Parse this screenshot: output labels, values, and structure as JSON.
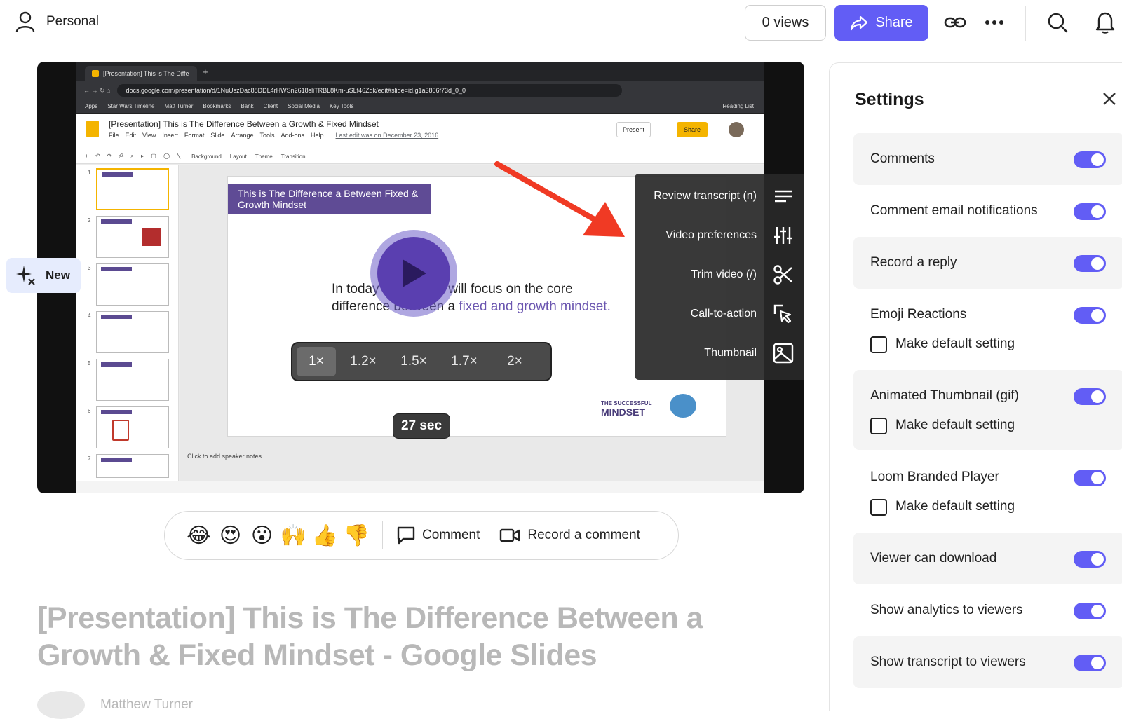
{
  "header": {
    "workspace": "Personal",
    "views_label": "0 views",
    "share_label": "Share"
  },
  "recording": {
    "browser_tab": "[Presentation] This is The Diffe",
    "url": "docs.google.com/presentation/d/1NuUszDac88DDL4rHWSn2618sliTRBL8Km-uSLf46Zqk/edit#slide=id.g1a3806f73d_0_0",
    "bookmarks": [
      "Apps",
      "Star Wars Timeline",
      "Matt Turner",
      "Bookmarks",
      "Bank",
      "Client",
      "Social Media",
      "Key Tools",
      "Reading List"
    ],
    "doc_title": "[Presentation] This is The Difference Between a Growth & Fixed Mindset",
    "doc_menu": [
      "File",
      "Edit",
      "View",
      "Insert",
      "Format",
      "Slide",
      "Arrange",
      "Tools",
      "Add-ons",
      "Help"
    ],
    "last_edit": "Last edit was on December 23, 2016",
    "present_label": "Present",
    "doc_share_label": "Share",
    "toolbar_items": [
      "Background",
      "Layout",
      "Theme",
      "Transition"
    ],
    "slide_title": "This is The  Difference a Between Fixed & Growth Mindset",
    "slide_text_1": "In today's video we will focus on the core",
    "slide_text_2": "difference between a",
    "slide_text_accent": "fixed and growth mindset.",
    "brand_top": "THE SUCCESSFUL",
    "brand_bottom": "MINDSET",
    "speaker_notes": "Click to add speaker notes",
    "slide_numbers": [
      "1",
      "2",
      "3",
      "4",
      "5",
      "6",
      "7"
    ]
  },
  "player": {
    "speeds": [
      "1×",
      "1.2×",
      "1.5×",
      "1.7×",
      "2×"
    ],
    "active_speed": "1×",
    "timer": "27 sec",
    "menu": [
      {
        "label": "Review transcript (n)",
        "icon": "lines-icon"
      },
      {
        "label": "Video preferences",
        "icon": "sliders-icon"
      },
      {
        "label": "Trim video (/)",
        "icon": "scissors-icon"
      },
      {
        "label": "Call-to-action",
        "icon": "cursor-icon"
      },
      {
        "label": "Thumbnail",
        "icon": "image-icon"
      }
    ],
    "accent_color": "#5a3fb0",
    "annotation_arrow_color": "#f03a24"
  },
  "new_badge": "New",
  "reactions": {
    "emojis": [
      "😂",
      "😍",
      "😮",
      "🙌",
      "👍",
      "👎"
    ],
    "comment_label": "Comment",
    "record_label": "Record a comment"
  },
  "video_title": "[Presentation] This is The Difference Between a Growth & Fixed Mindset - Google Slides",
  "author": "Matthew Turner",
  "settings": {
    "title": "Settings",
    "items": [
      {
        "label": "Comments",
        "on": true
      },
      {
        "label": "Comment email notifications",
        "on": true
      },
      {
        "label": "Record a reply",
        "on": true
      },
      {
        "label": "Emoji Reactions",
        "on": true,
        "default_label": "Make default setting"
      },
      {
        "label": "Animated Thumbnail (gif)",
        "on": true,
        "default_label": "Make default setting"
      },
      {
        "label": "Loom Branded Player",
        "on": true,
        "default_label": "Make default setting"
      },
      {
        "label": "Viewer can download",
        "on": true
      },
      {
        "label": "Show analytics to viewers",
        "on": true
      },
      {
        "label": "Show transcript to viewers",
        "on": true
      }
    ],
    "toggle_color": "#625df5"
  }
}
